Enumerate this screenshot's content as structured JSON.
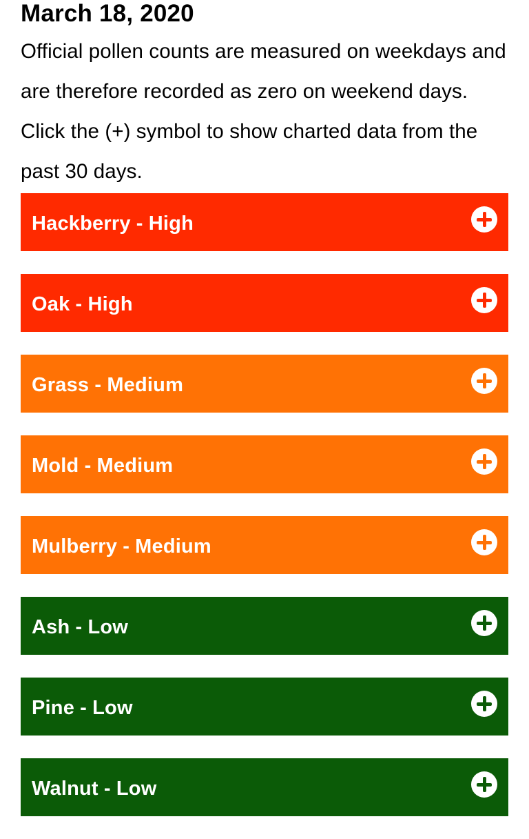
{
  "date": "March 18, 2020",
  "intro_text": "Official pollen counts are measured on weekdays and are therefore recorded as zero on weekend days. Click the (+) symbol to show charted data from the past 30 days.",
  "colors": {
    "High": "#ff2a00",
    "Medium": "#ff7205",
    "Low": "#0b5b07"
  },
  "expand_icon": "plus-circle-icon",
  "pollen_items": [
    {
      "name": "Hackberry",
      "level": "High"
    },
    {
      "name": "Oak",
      "level": "High"
    },
    {
      "name": "Grass",
      "level": "Medium"
    },
    {
      "name": "Mold",
      "level": "Medium"
    },
    {
      "name": "Mulberry",
      "level": "Medium"
    },
    {
      "name": "Ash",
      "level": "Low"
    },
    {
      "name": "Pine",
      "level": "Low"
    },
    {
      "name": "Walnut",
      "level": "Low"
    }
  ]
}
